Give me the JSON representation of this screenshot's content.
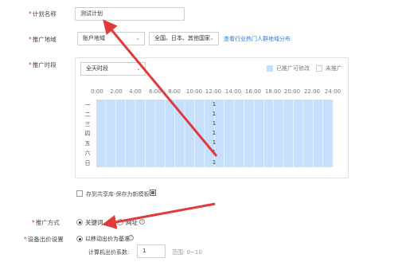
{
  "plan_name": {
    "label": "计划名称",
    "value": "测试计划"
  },
  "region": {
    "label": "推广地域",
    "mode_select": "账户地域",
    "region_select": "全国、日本、其他国家",
    "link": "查看行业热门人群地域分布"
  },
  "schedule": {
    "label": "推广时段",
    "preset_select": "全天时段",
    "legend": {
      "on_label": "已推广可修改",
      "off_label": "未推广",
      "on_color": "#c6e0fb",
      "off_color": "#ffffff"
    },
    "hours": [
      "0:00",
      "2:00",
      "4:00",
      "6:00",
      "8:00",
      "10:00",
      "12:00",
      "14:00",
      "16:00",
      "18:00",
      "20:00",
      "22:00",
      "24:00"
    ],
    "days": [
      "一",
      "二",
      "三",
      "四",
      "五",
      "六",
      "日"
    ],
    "multipliers": [
      "1",
      "1",
      "1",
      "1",
      "1",
      "1",
      "1"
    ],
    "save_template_label": "存到共享库-保存为新模板"
  },
  "promo_method": {
    "label": "推广方式",
    "options": [
      {
        "label": "关键词",
        "selected": true
      },
      {
        "label": "网址",
        "selected": false
      }
    ]
  },
  "device_bid": {
    "label": "设备出价设置",
    "option_label": "以移动出价为基准",
    "coef_label": "计算机出价系数:",
    "coef_value": "1",
    "range_text": "范围: 0~10"
  },
  "annotation_color": "#e03a3a"
}
